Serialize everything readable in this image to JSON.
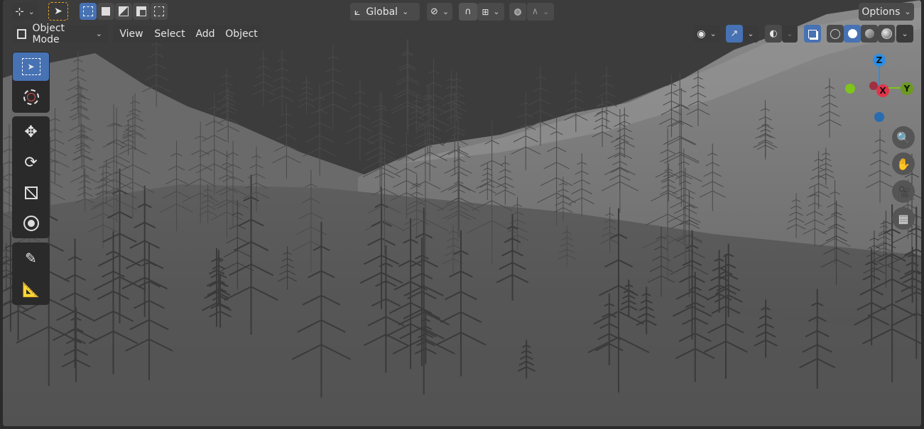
{
  "header": {
    "editor_type_icon": "editor-type-icon",
    "transform_orientation": "Global",
    "options_label": "Options"
  },
  "menubar": {
    "mode": "Object Mode",
    "items": [
      "View",
      "Select",
      "Add",
      "Object"
    ]
  },
  "gizmo": {
    "z": "Z",
    "x": "X",
    "y": "Y"
  },
  "colors": {
    "accent": "#4772b3",
    "x_axis": "#e0344a",
    "y_axis": "#7fc41b",
    "z_axis": "#2a8ee6"
  }
}
